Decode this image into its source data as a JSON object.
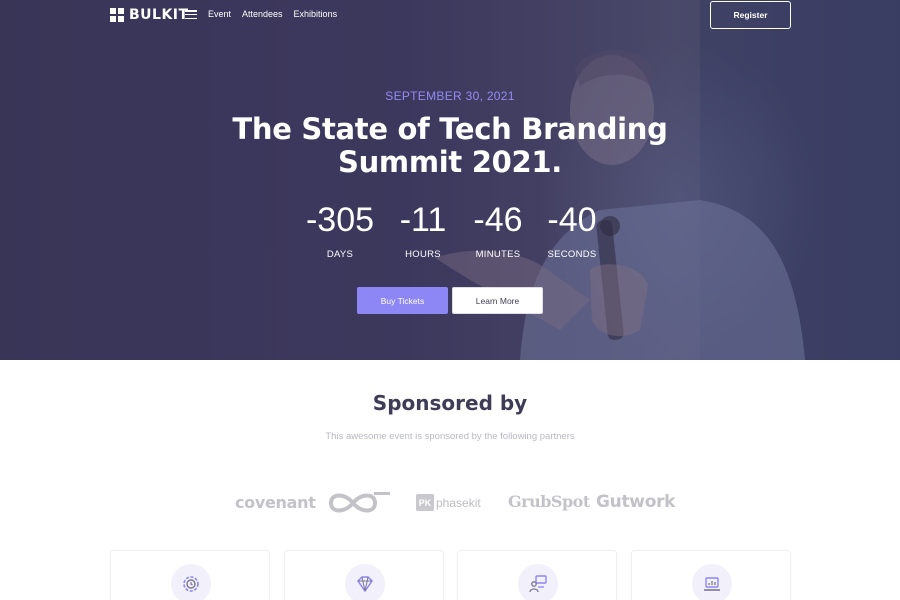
{
  "nav": {
    "brand": "BULKIT",
    "links": [
      "Event",
      "Attendees",
      "Exhibitions"
    ],
    "register_label": "Register"
  },
  "hero": {
    "date": "SEPTEMBER 30, 2021",
    "title": "The State of Tech Branding Summit 2021.",
    "countdown": [
      {
        "value": "-305",
        "label": "DAYS"
      },
      {
        "value": "-11",
        "label": "HOURS"
      },
      {
        "value": "-46",
        "label": "MINUTES"
      },
      {
        "value": "-40",
        "label": "SECONDS"
      }
    ],
    "buy_label": "Buy Tickets",
    "learn_label": "Learn More"
  },
  "sponsors": {
    "title": "Sponsored by",
    "subtitle": "This awesome event is sponsored by the following partners",
    "logos": [
      "covenant",
      "phasekit",
      "GrubSpot",
      "Gutwork"
    ],
    "phasekit_badge": "PK"
  },
  "feature_cards": [
    {
      "icon": "gear-icon"
    },
    {
      "icon": "diamond-icon"
    },
    {
      "icon": "presentation-icon"
    },
    {
      "icon": "laptop-chart-icon"
    }
  ],
  "colors": {
    "accent": "#8d86f5",
    "hero_overlay": "#3d3a5c",
    "heading": "#3f3d56",
    "logo_gray": "#c2c2c8"
  }
}
